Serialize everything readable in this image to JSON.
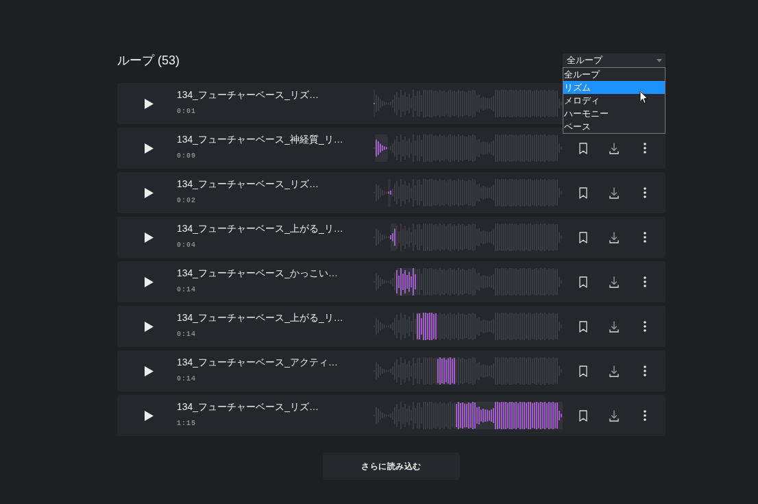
{
  "heading": "ループ (53)",
  "filter": {
    "value": "全ループ",
    "expanded": true,
    "options": [
      {
        "label": "全ループ",
        "highlighted": false
      },
      {
        "label": "リズム",
        "highlighted": true
      },
      {
        "label": "メロディ",
        "highlighted": false
      },
      {
        "label": "ハーモニー",
        "highlighted": false
      },
      {
        "label": "ベース",
        "highlighted": false
      }
    ]
  },
  "rows": [
    {
      "title": "134_フューチャーベース_リズ…",
      "duration": "0:01"
    },
    {
      "title": "134_フューチャーベース_神経質_リ…",
      "duration": "0:09"
    },
    {
      "title": "134_フューチャーベース_リズ…",
      "duration": "0:02"
    },
    {
      "title": "134_フューチャーベース_上がる_リ…",
      "duration": "0:04"
    },
    {
      "title": "134_フューチャーベース_かっこい…",
      "duration": "0:14"
    },
    {
      "title": "134_フューチャーベース_上がる_リ…",
      "duration": "0:14"
    },
    {
      "title": "134_フューチャーベース_アクティ…",
      "duration": "0:14"
    },
    {
      "title": "134_フューチャーベース_リズ…",
      "duration": "1:15"
    }
  ],
  "load_more": "さらに読み込む"
}
